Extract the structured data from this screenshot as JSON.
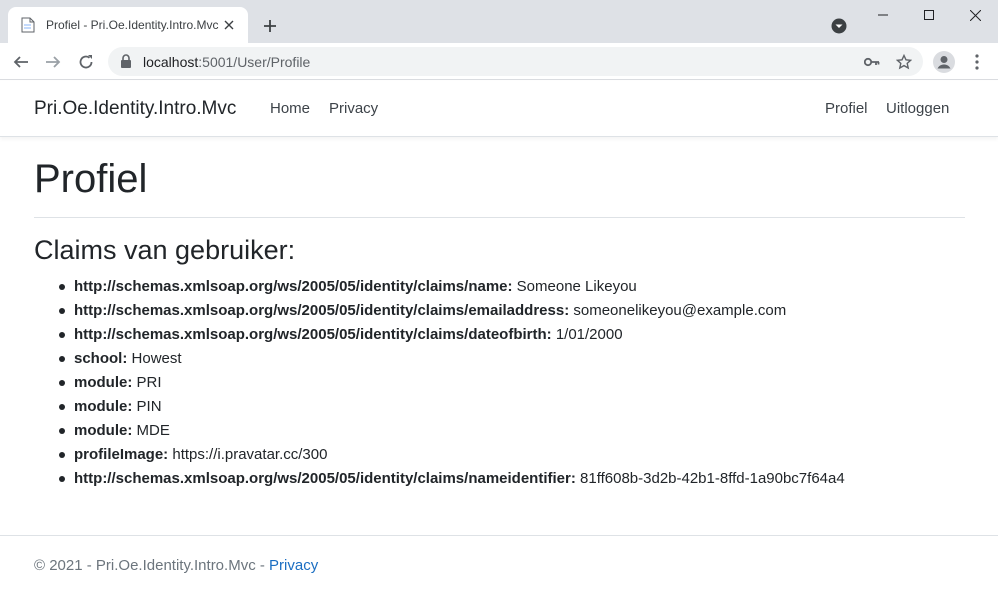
{
  "browser": {
    "tab_title": "Profiel - Pri.Oe.Identity.Intro.Mvc",
    "url_host": "localhost",
    "url_path": ":5001/User/Profile"
  },
  "nav": {
    "brand": "Pri.Oe.Identity.Intro.Mvc",
    "left_links": [
      "Home",
      "Privacy"
    ],
    "right_links": [
      "Profiel",
      "Uitloggen"
    ]
  },
  "page": {
    "title": "Profiel",
    "subtitle": "Claims van gebruiker:"
  },
  "claims": [
    {
      "key": "http://schemas.xmlsoap.org/ws/2005/05/identity/claims/name:",
      "value": "Someone Likeyou"
    },
    {
      "key": "http://schemas.xmlsoap.org/ws/2005/05/identity/claims/emailaddress:",
      "value": "someonelikeyou@example.com"
    },
    {
      "key": "http://schemas.xmlsoap.org/ws/2005/05/identity/claims/dateofbirth:",
      "value": "1/01/2000"
    },
    {
      "key": "school:",
      "value": "Howest"
    },
    {
      "key": "module:",
      "value": "PRI"
    },
    {
      "key": "module:",
      "value": "PIN"
    },
    {
      "key": "module:",
      "value": "MDE"
    },
    {
      "key": "profileImage:",
      "value": "https://i.pravatar.cc/300"
    },
    {
      "key": "http://schemas.xmlsoap.org/ws/2005/05/identity/claims/nameidentifier:",
      "value": "81ff608b-3d2b-42b1-8ffd-1a90bc7f64a4"
    }
  ],
  "footer": {
    "text": "© 2021 - Pri.Oe.Identity.Intro.Mvc - ",
    "link": "Privacy"
  },
  "colors": {
    "link": "#1b6ec2",
    "chrome_bg": "#dee1e6"
  }
}
